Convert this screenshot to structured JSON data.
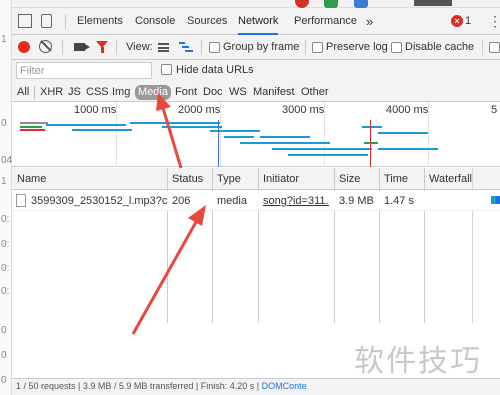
{
  "edge_numbers": [
    "1",
    "0",
    "04",
    "1",
    "0:",
    "0:",
    "0:",
    "0:",
    "0",
    "0",
    "0"
  ],
  "tabs": [
    {
      "label": "Elements",
      "active": false
    },
    {
      "label": "Console",
      "active": false
    },
    {
      "label": "Sources",
      "active": false
    },
    {
      "label": "Network",
      "active": true
    },
    {
      "label": "Performance",
      "active": false
    }
  ],
  "more_tabs": "»",
  "error_count": "1",
  "toolbar": {
    "view_label": "View:",
    "group_by_frame": "Group by frame",
    "preserve_log": "Preserve log",
    "disable_cache": "Disable cache"
  },
  "filter": {
    "placeholder": "Filter",
    "hide_data_urls": "Hide data URLs"
  },
  "types": [
    "All",
    "XHR",
    "JS",
    "CSS",
    "Img",
    "Media",
    "Font",
    "Doc",
    "WS",
    "Manifest",
    "Other"
  ],
  "active_type": "Media",
  "overview_ticks": [
    "1000 ms",
    "2000 ms",
    "3000 ms",
    "4000 ms",
    "5"
  ],
  "columns": [
    "Name",
    "Status",
    "Type",
    "Initiator",
    "Size",
    "Time",
    "Waterfall"
  ],
  "rows": [
    {
      "name": "3599309_2530152_l.mp3?cc...",
      "status": "206",
      "type": "media",
      "initiator": "song?id=311...",
      "size": "3.9 MB",
      "time": "1.47 s"
    }
  ],
  "status_bar": {
    "summary": "1 / 50 requests | 3.9 MB / 5.9 MB transferred | Finish: 4.20 s |",
    "dom_event": "DOMConte"
  },
  "watermark": "软件技巧",
  "colors": {
    "accent": "#1a73e8",
    "record": "#e8291c",
    "arrow": "#e8473c"
  }
}
